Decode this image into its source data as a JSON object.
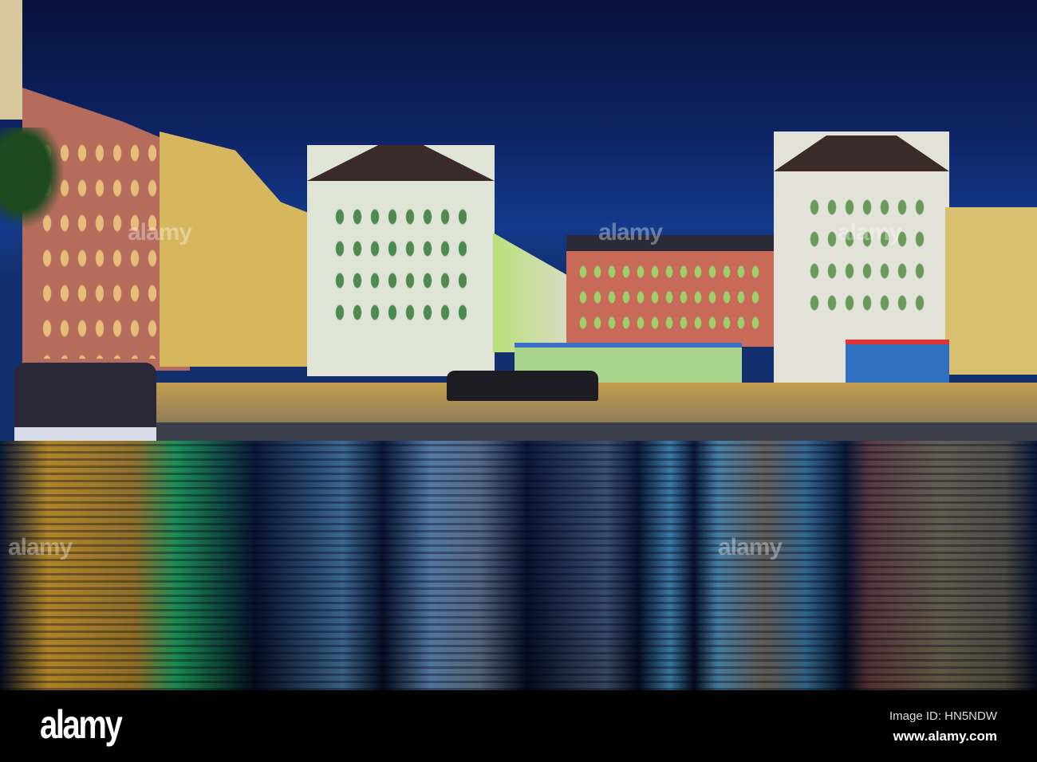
{
  "photo": {
    "description_colors": {
      "sky": "#0e2466",
      "water": "#06102a"
    }
  },
  "watermark": {
    "text": "alamy"
  },
  "footer": {
    "logo": "alamy",
    "image_id": "Image ID: HN5NDW",
    "url": "www.alamy.com"
  }
}
